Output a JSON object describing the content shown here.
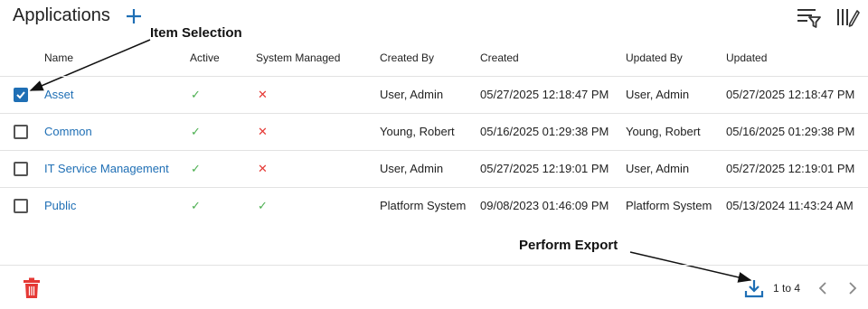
{
  "page": {
    "title": "Applications"
  },
  "annotations": {
    "item_selection": "Item Selection",
    "perform_export": "Perform Export"
  },
  "columns": [
    "Name",
    "Active",
    "System Managed",
    "Created By",
    "Created",
    "Updated By",
    "Updated"
  ],
  "rows": [
    {
      "selected": true,
      "name": "Asset",
      "active": "✓",
      "system_managed": "✕",
      "created_by": "User, Admin",
      "created": "05/27/2025 12:18:47 PM",
      "updated_by": "User, Admin",
      "updated": "05/27/2025 12:18:47 PM"
    },
    {
      "selected": false,
      "name": "Common",
      "active": "✓",
      "system_managed": "✕",
      "created_by": "Young, Robert",
      "created": "05/16/2025 01:29:38 PM",
      "updated_by": "Young, Robert",
      "updated": "05/16/2025 01:29:38 PM"
    },
    {
      "selected": false,
      "name": "IT Service Management",
      "active": "✓",
      "system_managed": "✕",
      "created_by": "User, Admin",
      "created": "05/27/2025 12:19:01 PM",
      "updated_by": "User, Admin",
      "updated": "05/27/2025 12:19:01 PM"
    },
    {
      "selected": false,
      "name": "Public",
      "active": "✓",
      "system_managed": "✓",
      "created_by": "Platform System",
      "created": "09/08/2023 01:46:09 PM",
      "updated_by": "Platform System",
      "updated": "05/13/2024 11:43:24 AM"
    }
  ],
  "pager": {
    "range": "1 to 4"
  },
  "icons": {
    "add": "plus-icon",
    "filter": "filter-icon",
    "columns": "column-picker-icon",
    "delete": "trash-icon",
    "export": "download-icon",
    "prev": "chevron-left-icon",
    "next": "chevron-right-icon"
  },
  "colors": {
    "accent": "#1f6fb5",
    "success": "#4caf50",
    "danger": "#e53935"
  }
}
